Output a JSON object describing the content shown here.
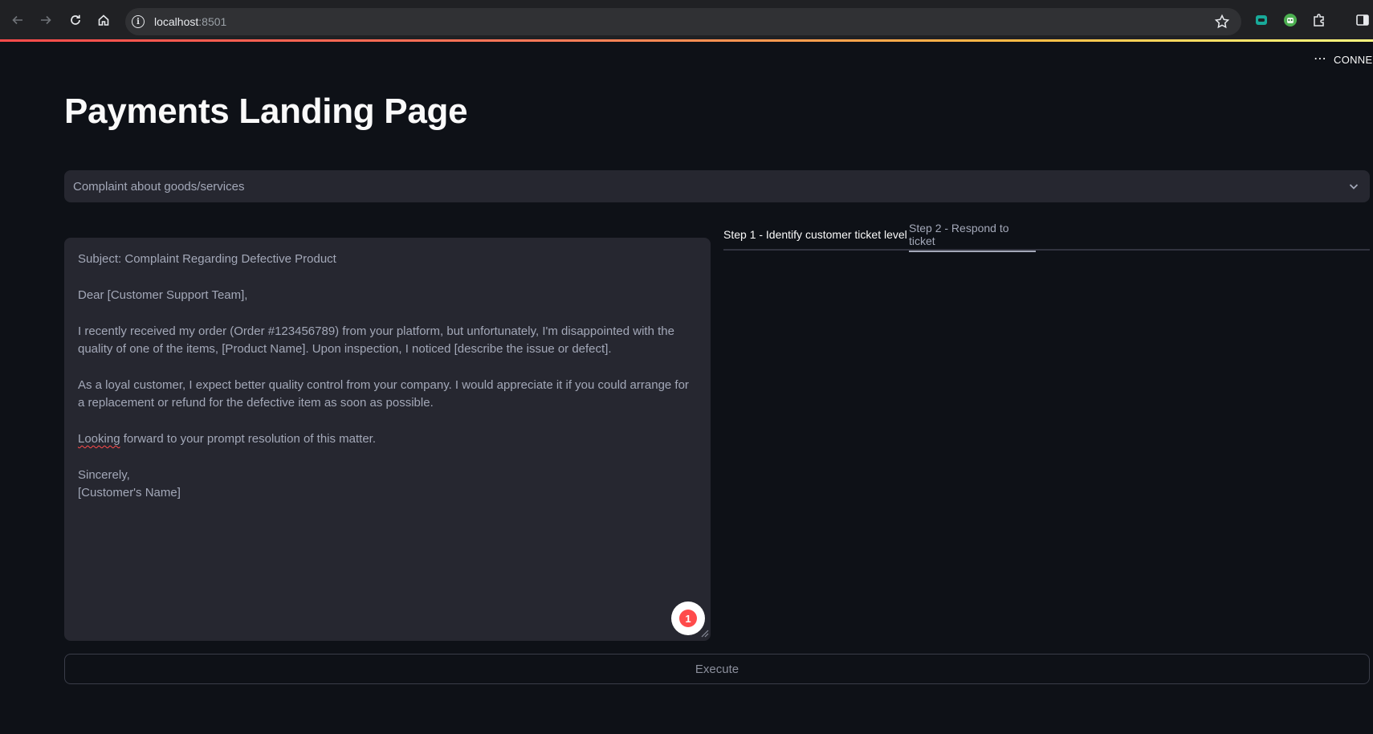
{
  "browser": {
    "url_host": "localhost",
    "url_port": ":8501"
  },
  "app": {
    "status_text": "CONNECTING",
    "title": "Payments Landing Page",
    "category_select": {
      "selected": "Complaint about goods/services"
    },
    "ticket": {
      "paragraphs": [
        "Subject: Complaint Regarding Defective Product",
        "Dear [Customer Support Team],",
        "I recently received my order (Order #123456789) from your platform, but unfortunately, I'm disappointed with the quality of one of the items, [Product Name]. Upon inspection, I noticed [describe the issue or defect].",
        "As a loyal customer, I expect better quality control from your company. I would appreciate it if you could arrange for a replacement or refund for the defective item as soon as possible."
      ],
      "closing_first_word": "Looking",
      "closing_rest": " forward to your prompt resolution of this matter.",
      "signoff": "Sincerely,\n[Customer's Name]",
      "badge_count": "1"
    },
    "tabs": [
      {
        "label": "Step 1 - Identify customer ticket level"
      },
      {
        "label": "Step 2 - Respond to ticket"
      }
    ],
    "execute_label": "Execute"
  },
  "colors": {
    "background": "#0e1117",
    "widget": "#262730",
    "accent": "#ff4b4b"
  }
}
